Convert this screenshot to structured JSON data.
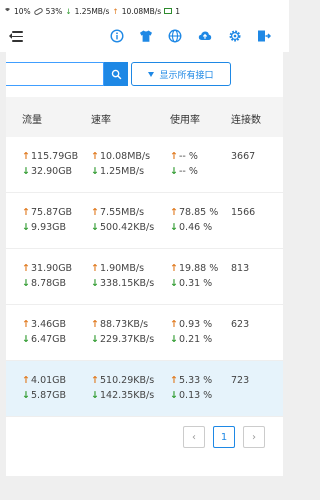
{
  "status_bar": {
    "battery1": "10%",
    "battery2": "53%",
    "down_speed": "1.25MB/s",
    "up_speed": "10.08MB/s",
    "screen_count": "1"
  },
  "toolbar": {
    "icons": [
      "menu-icon",
      "info-icon",
      "shirt-icon",
      "globe-icon",
      "cloud-upload-icon",
      "gear-icon",
      "exit-icon"
    ]
  },
  "filter": {
    "search_value": "",
    "filter_label": "显示所有接口"
  },
  "table": {
    "headers": [
      "流量",
      "速率",
      "使用率",
      "连接数"
    ],
    "rows": [
      {
        "traffic_up": "115.79GB",
        "traffic_down": "32.90GB",
        "rate_up": "10.08MB/s",
        "rate_down": "1.25MB/s",
        "usage_up": "-- %",
        "usage_down": "-- %",
        "connections": "3667",
        "highlighted": false
      },
      {
        "traffic_up": "75.87GB",
        "traffic_down": "9.93GB",
        "rate_up": "7.55MB/s",
        "rate_down": "500.42KB/s",
        "usage_up": "78.85 %",
        "usage_down": "0.46 %",
        "connections": "1566",
        "highlighted": false
      },
      {
        "traffic_up": "31.90GB",
        "traffic_down": "8.78GB",
        "rate_up": "1.90MB/s",
        "rate_down": "338.15KB/s",
        "usage_up": "19.88 %",
        "usage_down": "0.31 %",
        "connections": "813",
        "highlighted": false
      },
      {
        "traffic_up": "3.46GB",
        "traffic_down": "6.47GB",
        "rate_up": "88.73KB/s",
        "rate_down": "229.37KB/s",
        "usage_up": "0.93 %",
        "usage_down": "0.21 %",
        "connections": "623",
        "highlighted": false
      },
      {
        "traffic_up": "4.01GB",
        "traffic_down": "5.87GB",
        "rate_up": "510.29KB/s",
        "rate_down": "142.35KB/s",
        "usage_up": "5.33 %",
        "usage_down": "0.13 %",
        "connections": "723",
        "highlighted": true
      }
    ]
  },
  "pagination": {
    "prev": "‹",
    "current": "1",
    "next": "›"
  },
  "colors": {
    "accent": "#1e88e5",
    "up_arrow": "#e07a1f",
    "down_arrow": "#2e9a2e",
    "highlight_row": "#e6f3fb"
  }
}
